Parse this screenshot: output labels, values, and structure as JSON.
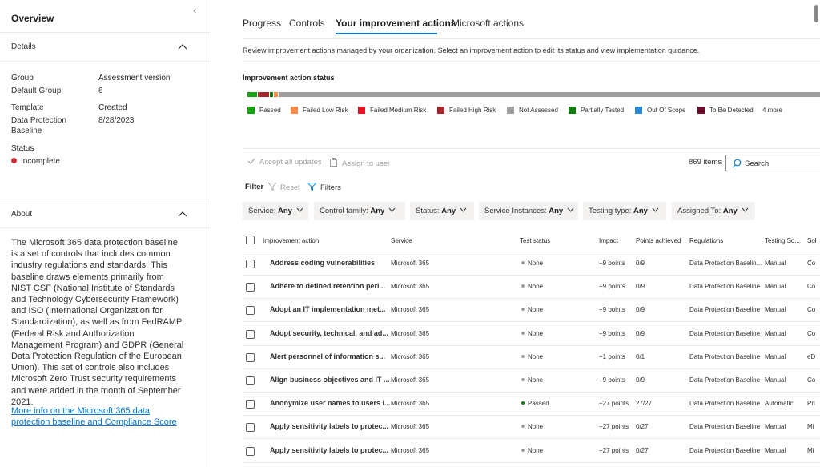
{
  "left": {
    "title": "Overview",
    "details_header": "Details",
    "group_label": "Group",
    "group_value": "Default Group",
    "assessment_version_label": "Assessment version",
    "assessment_version_value": "6",
    "template_label": "Template",
    "template_value_1": "Data Protection",
    "template_value_2": "Baseline",
    "created_label": "Created",
    "created_value": "8/28/2023",
    "status_label": "Status",
    "status_value": "Incomplete",
    "about_header": "About",
    "about_text": "The Microsoft 365 data protection baseline is a set of controls that includes common industry regulations and standards. This baseline draws elements primarily from NIST CSF (National Institute of Standards and Technology Cybersecurity Framework) and ISO (International Organization for Standardization), as well as from FedRAMP (Federal Risk and Authorization Management Program) and GDPR (General Data Protection Regulation of the European Union). This set of controls also includes Microsoft Zero Trust security requirements and were added in the month of September 2021.",
    "about_link": "More info on the Microsoft 365 data protection baseline and Compliance Score"
  },
  "tabs": [
    "Progress",
    "Controls",
    "Your improvement actions",
    "Microsoft actions"
  ],
  "description": "Review improvement actions managed by your organization. Select an improvement action to edit its status and view implementation guidance.",
  "status_section": {
    "title": "Improvement action status",
    "legend": [
      {
        "label": "Passed",
        "color": "#13a10e"
      },
      {
        "label": "Failed Low Risk",
        "color": "#f7894a"
      },
      {
        "label": "Failed Medium Risk",
        "color": "#e81123"
      },
      {
        "label": "Failed High Risk",
        "color": "#a4262c"
      },
      {
        "label": "Not Assessed",
        "color": "#a19f9d"
      },
      {
        "label": "Partially Tested",
        "color": "#107c10"
      },
      {
        "label": "Out Of Scope",
        "color": "#2b88d8"
      },
      {
        "label": "To Be Detected",
        "color": "#6b0f2a"
      }
    ],
    "more": "4 more"
  },
  "toolbar": {
    "accept_all": "Accept all updates",
    "assign": "Assign to user",
    "items_count": "869 items",
    "search_placeholder": "Search"
  },
  "filter_bar": {
    "filter_label": "Filter",
    "reset": "Reset",
    "filters": "Filters"
  },
  "pills": [
    {
      "label": "Service:",
      "value": "Any"
    },
    {
      "label": "Control family:",
      "value": "Any"
    },
    {
      "label": "Status:",
      "value": "Any"
    },
    {
      "label": "Service Instances:",
      "value": "Any"
    },
    {
      "label": "Testing type:",
      "value": "Any"
    },
    {
      "label": "Assigned To:",
      "value": "Any"
    }
  ],
  "table": {
    "headers": [
      "Improvement action",
      "Service",
      "Test status",
      "Impact",
      "Points achieved",
      "Regulations",
      "Testing So...",
      "Sol"
    ],
    "rows": [
      {
        "name": "Address coding vulnerabilities",
        "service": "Microsoft 365",
        "status": "None",
        "impact": "+9 points",
        "points": "0/9",
        "regulations": "Data Protection Baselin...",
        "testing": "Manual",
        "sol": "Co"
      },
      {
        "name": "Adhere to defined retention peri...",
        "service": "Microsoft 365",
        "status": "None",
        "impact": "+9 points",
        "points": "0/9",
        "regulations": "Data Protection Baseline",
        "testing": "Manual",
        "sol": "Co"
      },
      {
        "name": "Adopt an IT implementation met...",
        "service": "Microsoft 365",
        "status": "None",
        "impact": "+9 points",
        "points": "0/9",
        "regulations": "Data Protection Baseline",
        "testing": "Manual",
        "sol": "Co"
      },
      {
        "name": "Adopt security, technical, and ad...",
        "service": "Microsoft 365",
        "status": "None",
        "impact": "+9 points",
        "points": "0/9",
        "regulations": "Data Protection Baseline",
        "testing": "Manual",
        "sol": "Co"
      },
      {
        "name": "Alert personnel of information s...",
        "service": "Microsoft 365",
        "status": "None",
        "impact": "+1 points",
        "points": "0/1",
        "regulations": "Data Protection Baseline",
        "testing": "Manual",
        "sol": "eD"
      },
      {
        "name": "Align business objectives and IT ...",
        "service": "Microsoft 365",
        "status": "None",
        "impact": "+9 points",
        "points": "0/9",
        "regulations": "Data Protection Baseline",
        "testing": "Manual",
        "sol": "Co"
      },
      {
        "name": "Anonymize user names to users i...",
        "service": "Microsoft 365",
        "status": "Passed",
        "impact": "+27 points",
        "points": "27/27",
        "regulations": "Data Protection Baseline",
        "testing": "Automatic",
        "sol": "Pri"
      },
      {
        "name": "Apply sensitivity labels to protec...",
        "service": "Microsoft 365",
        "status": "None",
        "impact": "+27 points",
        "points": "0/27",
        "regulations": "Data Protection Baseline",
        "testing": "Manual",
        "sol": "Mi"
      },
      {
        "name": "Apply sensitivity labels to protec...",
        "service": "Microsoft 365",
        "status": "None",
        "impact": "+27 points",
        "points": "0/27",
        "regulations": "Data Protection Baseline",
        "testing": "Manual",
        "sol": "Mi"
      }
    ]
  }
}
